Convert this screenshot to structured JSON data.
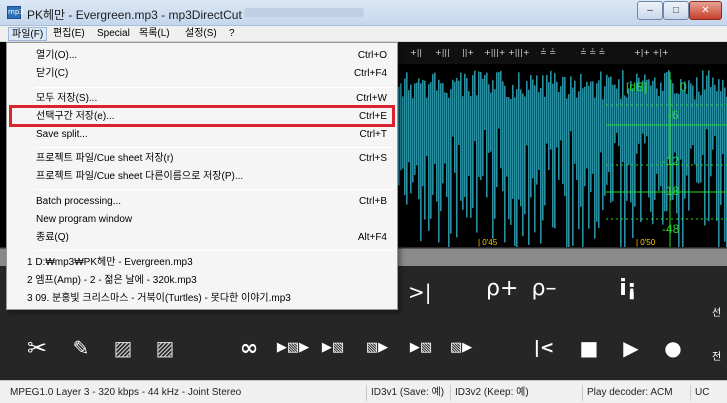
{
  "window": {
    "title": "PK헤만 - Evergreen.mp3 - mp3DirectCut",
    "app_icon": "mp3",
    "controls": {
      "minimize": "–",
      "maximize": "□",
      "close": "✕"
    }
  },
  "menubar": {
    "items": [
      "파일(F)",
      "편집(E)",
      "Special",
      "목록(L)",
      "설정(S)",
      "?"
    ]
  },
  "file_menu": {
    "items": [
      {
        "label": "열기(O)...",
        "shortcut": "Ctrl+O"
      },
      {
        "label": "닫기(C)",
        "shortcut": "Ctrl+F4"
      },
      {
        "label": "모두 저장(S)...",
        "shortcut": "Ctrl+W"
      },
      {
        "label": "선택구간 저장(e)...",
        "shortcut": "Ctrl+E"
      },
      {
        "label": "Save split...",
        "shortcut": "Ctrl+T"
      },
      {
        "label": "프로젝트 파일/Cue sheet 저장(r)",
        "shortcut": "Ctrl+S"
      },
      {
        "label": "프로젝트 파일/Cue sheet 다른이름으로 저장(P)...",
        "shortcut": ""
      },
      {
        "label": "Batch processing...",
        "shortcut": "Ctrl+B"
      },
      {
        "label": "New program window",
        "shortcut": ""
      },
      {
        "label": "종료(Q)",
        "shortcut": "Alt+F4"
      },
      {
        "label": "1 D:₩mp3₩PK헤만 - Evergreen.mp3",
        "shortcut": ""
      },
      {
        "label": "2 엠프(Amp) - 2 - 젊은 날에 - 320k.mp3",
        "shortcut": ""
      },
      {
        "label": "3 09. 분홍빛 크리스마스 - 거북이(Turtles) - 못다한 이야기.mp3",
        "shortcut": ""
      }
    ]
  },
  "waveform": {
    "db_scale": [
      "[dB]",
      "0",
      "-6",
      "-12",
      "-18",
      "-48"
    ],
    "time_markers": [
      "| 0'45",
      "| 0'50"
    ],
    "colors": {
      "wave": "#2a8fa0",
      "db_text": "#22dd22",
      "background": "#000000"
    }
  },
  "toolbar": {
    "icons": [
      "cut-icon",
      "pencil-icon",
      "fade-in-icon",
      "fade-out-icon",
      "loop-icon",
      "play-selection-icon",
      "skip-to-selection-icon",
      "play-to-cue-icon",
      "play-from-cue-icon",
      "play-after-icon",
      "go-start-icon",
      "stop-icon",
      "play-icon",
      "record-icon",
      "zoom-in-icon",
      "zoom-out-icon",
      "info-icon",
      "next-cue-icon"
    ],
    "glyphs": {
      "cut": "✂",
      "pencil": "✎",
      "fade_in": "▨",
      "fade_out": "▨",
      "loop": "∞",
      "p1": "▶▧▶",
      "p2": "▶▧",
      "p3": "▧▶",
      "p4": "▶▧",
      "p5": "▧▶",
      "go_start": "|<",
      "stop": "■",
      "play": "▶",
      "record": "●",
      "zoom_in": "ρ+",
      "zoom_out": "ρ–",
      "info": "i¡",
      "next": ">|"
    },
    "side_text": [
      "선",
      "전"
    ]
  },
  "statusbar": {
    "format": "MPEG1.0 Layer 3 - 320 kbps - 44 kHz - Joint Stereo",
    "id3v1": "ID3v1 (Save: 예)",
    "id3v2": "ID3v2 (Keep: 예)",
    "decoder": "Play decoder: ACM",
    "extra": "UC"
  }
}
